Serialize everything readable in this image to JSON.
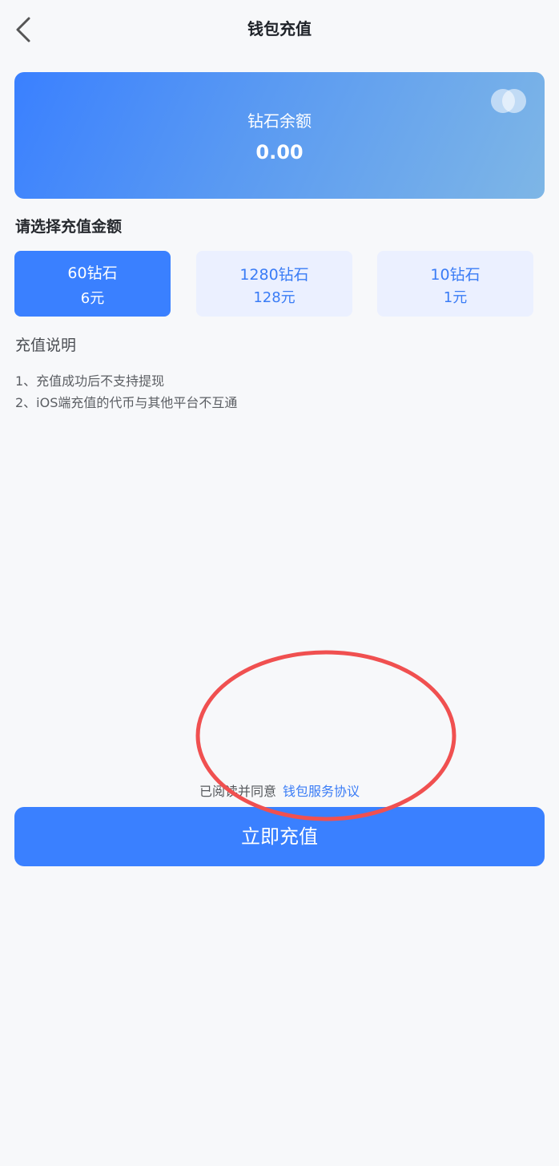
{
  "header": {
    "title": "钱包充值"
  },
  "balance": {
    "label": "钻石余额",
    "value": "0.00"
  },
  "select_label": "请选择充值金额",
  "options": [
    {
      "diamonds": "60钻石",
      "price": "6元",
      "selected": true
    },
    {
      "diamonds": "1280钻石",
      "price": "128元",
      "selected": false
    },
    {
      "diamonds": "10钻石",
      "price": "1元",
      "selected": false
    }
  ],
  "description": {
    "title": "充值说明",
    "items": [
      "1、充值成功后不支持提现",
      "2、iOS端充值的代币与其他平台不互通"
    ]
  },
  "agreement": {
    "text": "已阅读并同意",
    "link": "钱包服务协议"
  },
  "submit_label": "立即充值",
  "colors": {
    "primary": "#3a80ff",
    "option_bg": "#ebf0ff",
    "annotation": "#f05050"
  },
  "icons": {
    "back": "chevron-left-icon",
    "coins": "coins-icon"
  }
}
